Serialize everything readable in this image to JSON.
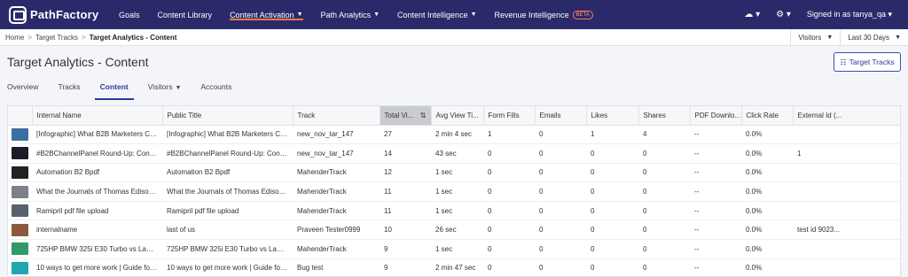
{
  "nav": {
    "brand": "PathFactory",
    "items": [
      {
        "label": "Goals",
        "caret": false,
        "active": false
      },
      {
        "label": "Content Library",
        "caret": false,
        "active": false
      },
      {
        "label": "Content Activation",
        "caret": true,
        "active": true
      },
      {
        "label": "Path Analytics",
        "caret": true,
        "active": false
      },
      {
        "label": "Content Intelligence",
        "caret": true,
        "active": false
      },
      {
        "label": "Revenue Intelligence",
        "caret": false,
        "active": false,
        "badge": "BETA"
      }
    ],
    "right": {
      "cloud_icon": "cloud-upload-icon",
      "gear_icon": "gear-icon",
      "user": "Signed in as tanya_qa"
    }
  },
  "breadcrumb": {
    "home": "Home",
    "parent": "Target Tracks",
    "current": "Target Analytics - Content",
    "sep": ">"
  },
  "filters": {
    "visitors": "Visitors",
    "range": "Last 30 Days"
  },
  "page": {
    "title": "Target Analytics - Content",
    "action_button": "Target Tracks",
    "action_icon": "grid-icon"
  },
  "tabs": [
    {
      "label": "Overview",
      "active": false,
      "caret": false
    },
    {
      "label": "Tracks",
      "active": false,
      "caret": false
    },
    {
      "label": "Content",
      "active": true,
      "caret": false
    },
    {
      "label": "Visitors",
      "active": false,
      "caret": true
    },
    {
      "label": "Accounts",
      "active": false,
      "caret": false
    }
  ],
  "table": {
    "columns": [
      "",
      "Internal Name",
      "Public Title",
      "Track",
      "Total Vi...",
      "Avg View Ti...",
      "Form Fills",
      "Emails",
      "Likes",
      "Shares",
      "PDF Downlo...",
      "Click Rate",
      "External Id (..."
    ],
    "sorted_column": 4,
    "rows": [
      {
        "thumb": "#3b6fa0",
        "cells": [
          "[Infographic] What B2B Marketers Ca...",
          "[Infographic] What B2B Marketers Ca...",
          "new_nov_tar_147",
          "27",
          "2 min 4 sec",
          "1",
          "0",
          "1",
          "4",
          "--",
          "0.0%",
          ""
        ]
      },
      {
        "thumb": "#1c1c28",
        "cells": [
          "#B2BChannelPanel Round-Up: Conte...",
          "#B2BChannelPanel Round-Up: Conte...",
          "new_nov_tar_147",
          "14",
          "43 sec",
          "0",
          "0",
          "0",
          "0",
          "--",
          "0.0%",
          "1"
        ]
      },
      {
        "thumb": "#222222",
        "cells": [
          "Automation B2 Bpdf",
          "Automation B2 Bpdf",
          "MahenderTrack",
          "12",
          "1 sec",
          "0",
          "0",
          "0",
          "0",
          "--",
          "0.0%",
          ""
        ]
      },
      {
        "thumb": "#7d8088",
        "cells": [
          "What the Journals of Thomas Edison...",
          "What the Journals of Thomas Edison...",
          "MahenderTrack",
          "11",
          "1 sec",
          "0",
          "0",
          "0",
          "0",
          "--",
          "0.0%",
          ""
        ]
      },
      {
        "thumb": "#5a6070",
        "cells": [
          "Ramipril pdf file upload",
          "Ramipril pdf file upload",
          "MahenderTrack",
          "11",
          "1 sec",
          "0",
          "0",
          "0",
          "0",
          "--",
          "0.0%",
          ""
        ]
      },
      {
        "thumb": "#8a5a3a",
        "cells": [
          "internalname",
          "last of us",
          "Praveen Tester0999",
          "10",
          "26 sec",
          "0",
          "0",
          "0",
          "0",
          "--",
          "0.0%",
          "test id 9023..."
        ]
      },
      {
        "thumb": "#2f9a6a",
        "cells": [
          "725HP BMW 325i E30 Turbo vs Lam...",
          "725HP BMW 325i E30 Turbo vs Lam...",
          "MahenderTrack",
          "9",
          "1 sec",
          "0",
          "0",
          "0",
          "0",
          "--",
          "0.0%",
          ""
        ]
      },
      {
        "thumb": "#1fa6b0",
        "cells": [
          "10 ways to get more work | Guide for ...",
          "10 ways to get more work | Guide for ...",
          "Bug test",
          "9",
          "2 min 47 sec",
          "0",
          "0",
          "0",
          "0",
          "--",
          "0.0%",
          ""
        ]
      }
    ]
  }
}
